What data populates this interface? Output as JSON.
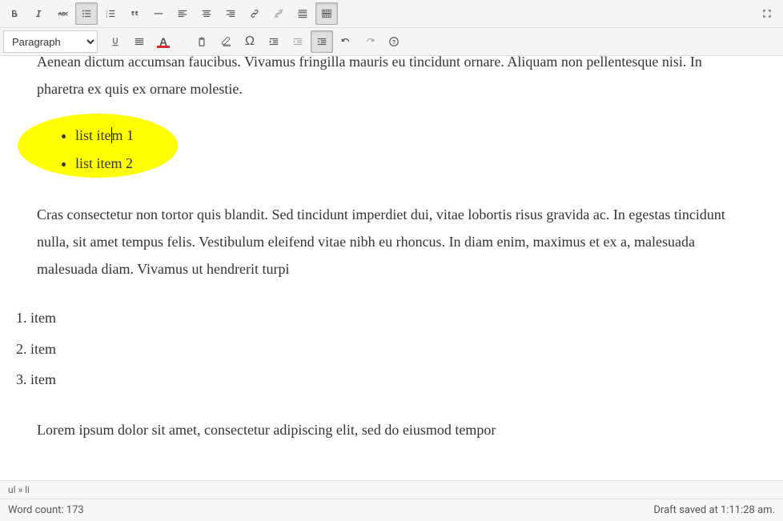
{
  "format_selector": {
    "value": "Paragraph"
  },
  "content": {
    "para1": "Aenean dictum accumsan faucibus. Vivamus fringilla mauris eu tincidunt ornare. Aliquam non pellentesque nisi. In pharetra ex quis ex ornare molestie.",
    "ul": [
      "list item 1",
      "list item 2"
    ],
    "ul_caret_item": 0,
    "ul_caret_split": [
      "list ite",
      "m 1"
    ],
    "para2": "Cras consectetur non tortor quis blandit. Sed tincidunt imperdiet dui, vitae lobortis risus gravida ac. In egestas tincidunt nulla, sit amet tempus felis. Vestibulum eleifend vitae nibh eu rhoncus. In diam enim, maximus et ex a, malesuada malesuada diam. Vivamus ut hendrerit turpi",
    "ol": [
      "item",
      "item",
      "item"
    ],
    "para3": "Lorem ipsum dolor sit amet, consectetur adipiscing elit, sed do eiusmod tempor"
  },
  "path_bar": "ul » li",
  "status": {
    "word_count_label": "Word count: ",
    "word_count": "173",
    "draft_saved": "Draft saved at 1:11:28 am."
  }
}
